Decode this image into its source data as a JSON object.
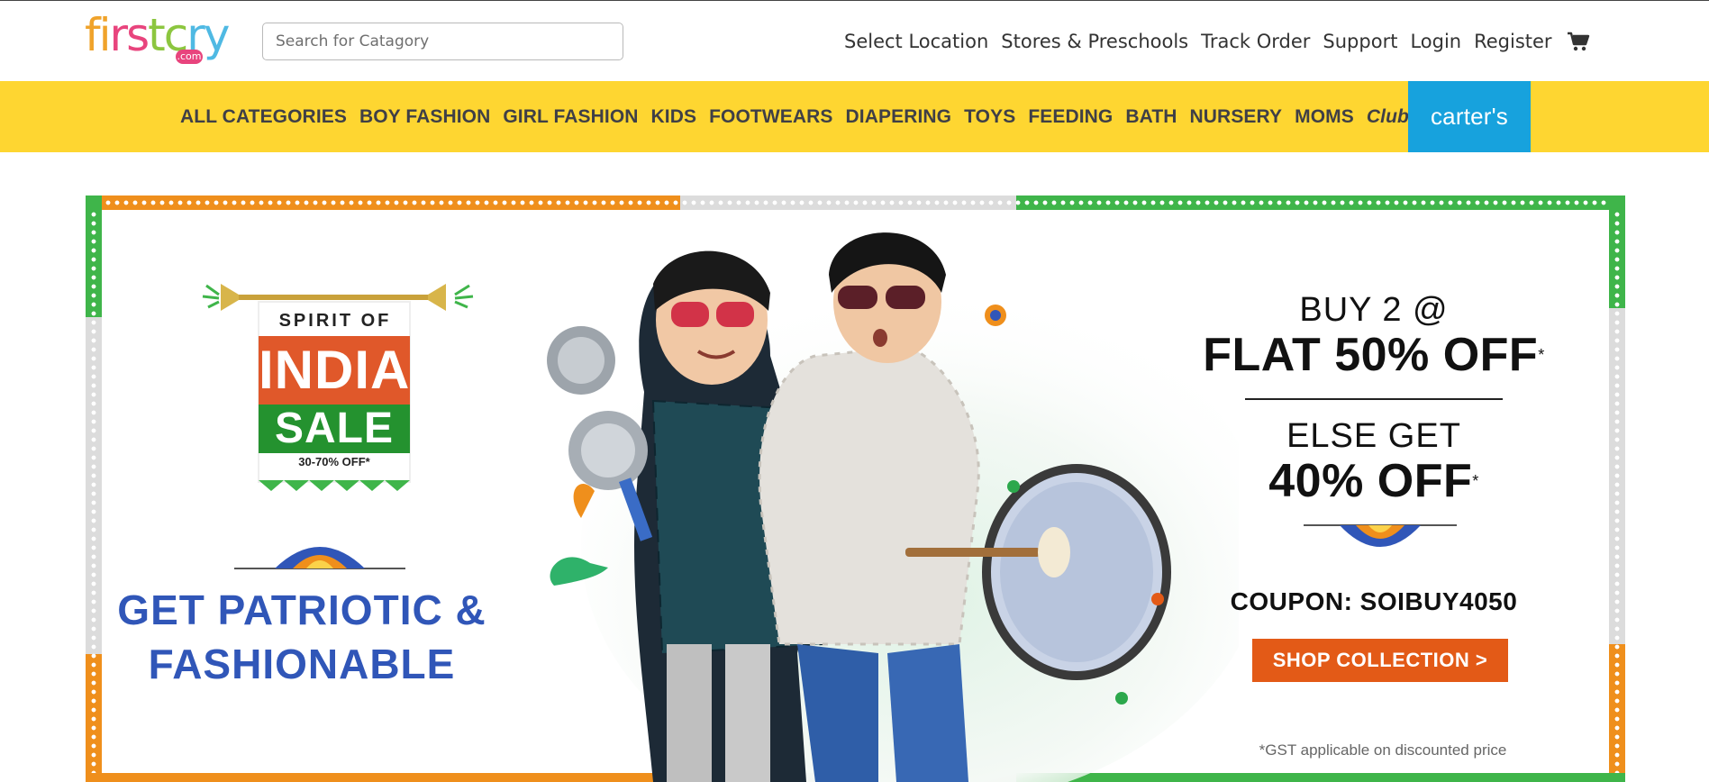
{
  "header": {
    "logo_text": "firstcry",
    "logo_letters": [
      "f",
      "i",
      "r",
      "s",
      "t",
      "c",
      "r",
      "y"
    ],
    "logo_colors": [
      "#f0a32b",
      "#f0a32b",
      "#e8447d",
      "#e8447d",
      "#8cc63f",
      "#8cc63f",
      "#4fb9e3",
      "#4fb9e3"
    ],
    "logo_sub": ".com",
    "search_placeholder": "Search for Catagory",
    "nav": [
      "Select Location",
      "Stores & Preschools",
      "Track Order",
      "Support",
      "Login",
      "Register"
    ],
    "cart_icon": "cart-icon"
  },
  "category_bar": {
    "background": "#fed631",
    "items": [
      "ALL CATEGORIES",
      "BOY FASHION",
      "GIRL FASHION",
      "KIDS",
      "FOOTWEARS",
      "DIAPERING",
      "TOYS",
      "FEEDING",
      "BATH",
      "NURSERY",
      "MOMS"
    ],
    "club_label": "Club",
    "carters_label": "carter's",
    "carters_color": "#17a2dd"
  },
  "banner": {
    "badge": {
      "spirit": "SPIRIT OF",
      "india": "INDIA",
      "sale": "SALE",
      "discount": "30-70% OFF*"
    },
    "tagline_line1": "GET PATRIOTIC &",
    "tagline_line2": "FASHIONABLE",
    "offer_buy": "BUY 2 @",
    "offer_flat": "FLAT 50% OFF",
    "offer_asterisk": "*",
    "offer_else": "ELSE GET",
    "offer_40": "40% OFF",
    "coupon": "COUPON: SOIBUY4050",
    "cta": "SHOP COLLECTION >",
    "disclaimer": "*GST applicable on discounted price",
    "frame_colors": {
      "saffron": "#ef8f1c",
      "white": "#dcdcdc",
      "green": "#3fb54a"
    }
  }
}
